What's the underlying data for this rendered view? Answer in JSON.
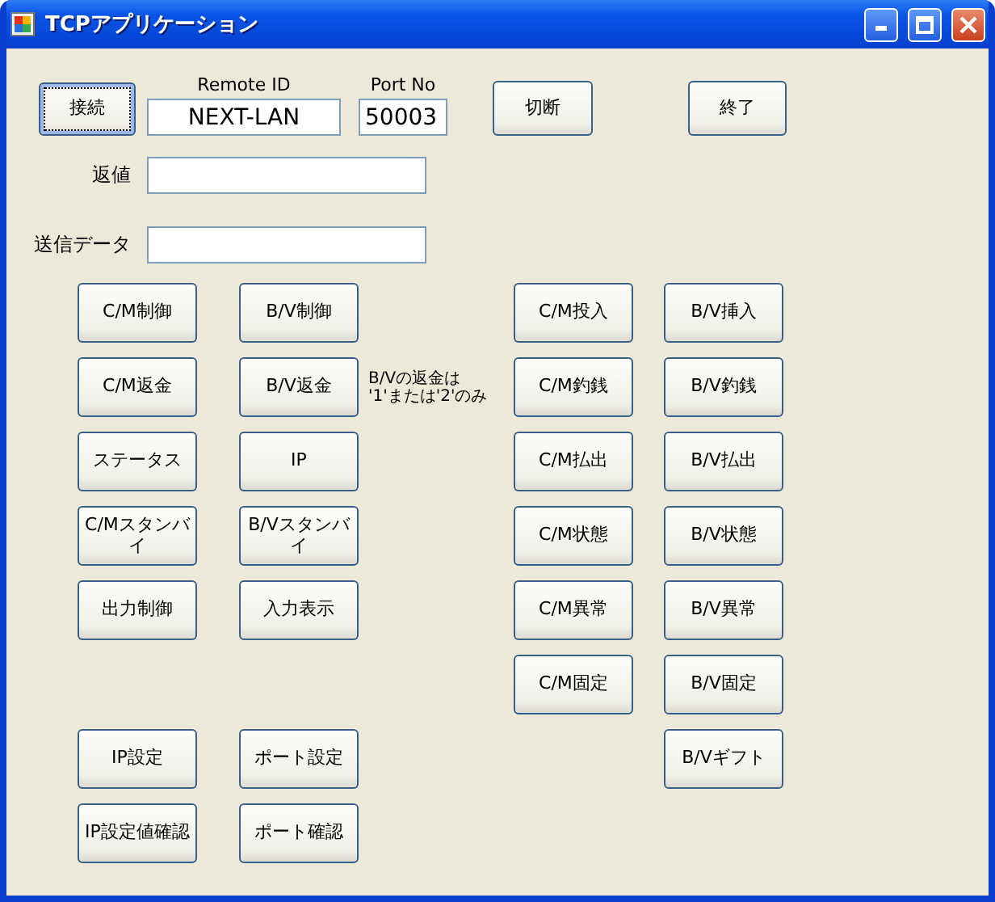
{
  "window": {
    "title": "TCPアプリケーション"
  },
  "connection": {
    "connect_button": "接続",
    "remote_id": {
      "label": "Remote ID",
      "value": "NEXT-LAN"
    },
    "port_no": {
      "label": "Port No",
      "value": "50003"
    },
    "disconnect_button": "切断",
    "exit_button": "終了"
  },
  "fields": [
    {
      "label": "返値"
    },
    {
      "label": "送信データ"
    }
  ],
  "left_buttons": {
    "control": [
      "C/M制御",
      "B/V制御",
      "C/M返金",
      "B/V返金",
      "ステータス",
      "IP",
      "C/Mスタンバイ",
      "B/Vスタンバイ",
      "出力制御",
      "入力表示"
    ],
    "note": "B/Vの返金は\n'1'または'2'のみ",
    "settings": [
      "IP設定",
      "ポート設定",
      "IP設定値確認",
      "ポート確認"
    ]
  },
  "right_columns": [
    [
      "C/M投入",
      "C/M釣銭",
      "C/M払出",
      "C/M状態",
      "C/M異常",
      "C/M固定"
    ],
    [
      "B/V挿入",
      "B/V釣銭",
      "B/V払出",
      "B/V状態",
      "B/V異常",
      "B/V固定",
      "B/Vギフト"
    ]
  ]
}
